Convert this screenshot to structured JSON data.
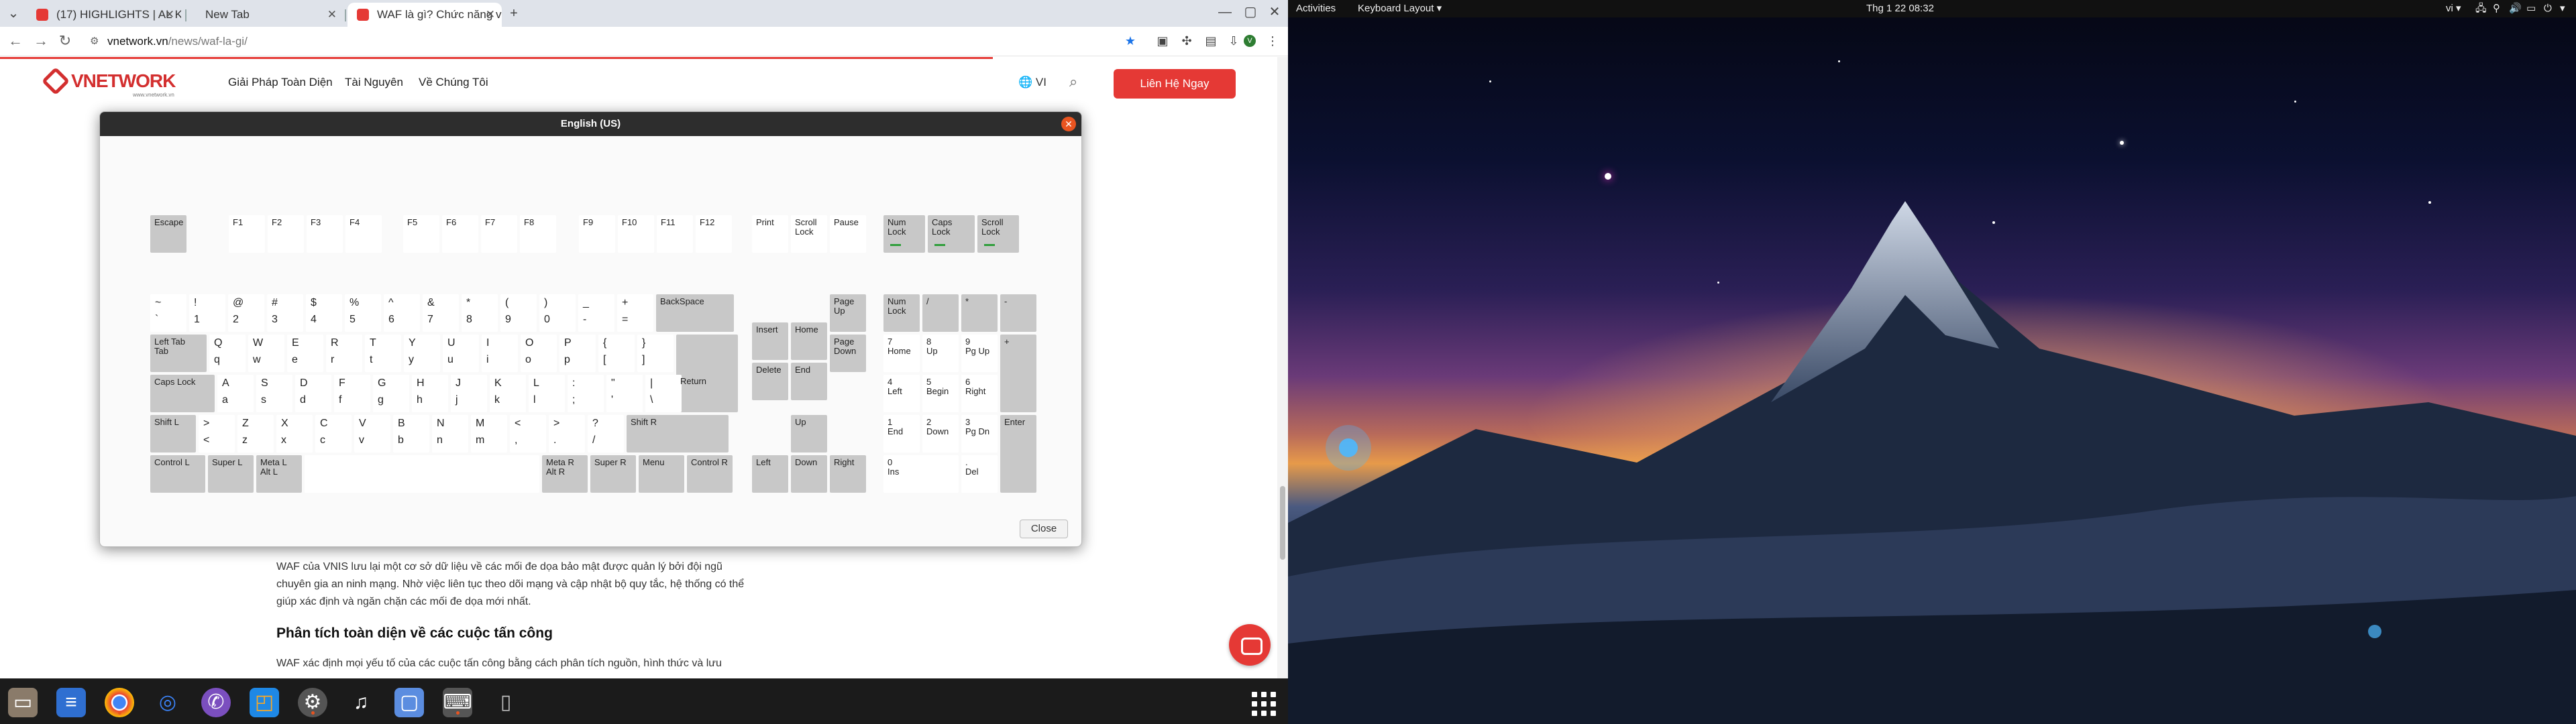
{
  "browser": {
    "tabs": [
      {
        "label": "(17) HIGHLIGHTS | AL KH",
        "active": false,
        "favicon_color": "#e53935"
      },
      {
        "label": "New Tab",
        "active": false,
        "favicon_color": "#3b3b3b"
      },
      {
        "label": "WAF là gì? Chức năng v",
        "active": true,
        "favicon_color": "#e53935"
      }
    ],
    "url_host": "vnetwork.vn",
    "url_path": "/news/waf-la-gi/"
  },
  "site": {
    "logo_text": "VNETWORK",
    "logo_tagline": "www.vnetwork.vn",
    "nav": [
      "Giải Pháp Toàn Diện",
      "Tài Nguyên",
      "Về Chúng Tôi"
    ],
    "language": "VI",
    "cta": "Liên Hệ Ngay",
    "article": {
      "paragraph_1": "WAF của VNIS lưu lại một cơ sở dữ liệu về các mối đe dọa bảo mật được quản lý bởi đội ngũ chuyên gia an ninh mạng. Nhờ việc liên tục theo dõi mạng và cập nhật bộ quy tắc, hệ thống có thể giúp xác định và ngăn chặn các mối đe dọa mới nhất.",
      "heading": "Phân tích toàn diện về các cuộc tấn công",
      "paragraph_2": "WAF xác định mọi yếu tố của các cuộc tấn công bằng cách phân tích nguồn, hình thức và lưu"
    }
  },
  "dialog": {
    "title": "English (US)",
    "close_label": "Close",
    "keys": {
      "esc": "Escape",
      "f1": "F1",
      "f2": "F2",
      "f3": "F3",
      "f4": "F4",
      "f5": "F5",
      "f6": "F6",
      "f7": "F7",
      "f8": "F8",
      "f9": "F9",
      "f10": "F10",
      "f11": "F11",
      "f12": "F12",
      "print": "Print",
      "scroll_lock": "Scroll\nLock",
      "pause": "Pause",
      "ind_num": "Num\nLock",
      "ind_caps": "Caps\nLock",
      "ind_scroll": "Scroll\nLock",
      "num_row": [
        [
          "~",
          "`"
        ],
        [
          "!",
          "1"
        ],
        [
          "@",
          "2"
        ],
        [
          "#",
          "3"
        ],
        [
          "$",
          "4"
        ],
        [
          "%",
          "5"
        ],
        [
          "^",
          "6"
        ],
        [
          "&",
          "7"
        ],
        [
          "*",
          "8"
        ],
        [
          "(",
          "9"
        ],
        [
          ")",
          "0"
        ],
        [
          "_",
          "-"
        ],
        [
          "+",
          "="
        ]
      ],
      "backspace": "BackSpace",
      "tab": "Left Tab\nTab",
      "q_row": [
        [
          "Q",
          "q"
        ],
        [
          "W",
          "w"
        ],
        [
          "E",
          "e"
        ],
        [
          "R",
          "r"
        ],
        [
          "T",
          "t"
        ],
        [
          "Y",
          "y"
        ],
        [
          "U",
          "u"
        ],
        [
          "I",
          "i"
        ],
        [
          "O",
          "o"
        ],
        [
          "P",
          "p"
        ],
        [
          "{",
          "["
        ],
        [
          "}",
          "]"
        ]
      ],
      "capslock": "Caps Lock",
      "a_row": [
        [
          "A",
          "a"
        ],
        [
          "S",
          "s"
        ],
        [
          "D",
          "d"
        ],
        [
          "F",
          "f"
        ],
        [
          "G",
          "g"
        ],
        [
          "H",
          "h"
        ],
        [
          "J",
          "j"
        ],
        [
          "K",
          "k"
        ],
        [
          "L",
          "l"
        ],
        [
          ":",
          ";"
        ],
        [
          "\"",
          "'"
        ],
        [
          "|",
          "\\"
        ]
      ],
      "return": "Return",
      "shift_l": "Shift L",
      "z_row": [
        [
          ">",
          "<"
        ],
        [
          "Z",
          "z"
        ],
        [
          "X",
          "x"
        ],
        [
          "C",
          "c"
        ],
        [
          "V",
          "v"
        ],
        [
          "B",
          "b"
        ],
        [
          "N",
          "n"
        ],
        [
          "M",
          "m"
        ],
        [
          "<",
          ","
        ],
        [
          ">",
          "."
        ],
        [
          "?",
          "/"
        ]
      ],
      "z_row_extra": [
        "¦",
        "|"
      ],
      "shift_r": "Shift R",
      "control_l": "Control L",
      "super_l": "Super L",
      "meta_l": "Meta L\nAlt L",
      "meta_r": "Meta R\nAlt R",
      "super_r": "Super R",
      "menu": "Menu",
      "control_r": "Control R",
      "insert": "Insert",
      "home": "Home",
      "page_up": "Page\nUp",
      "delete": "Delete",
      "end": "End",
      "page_down": "Page\nDown",
      "up": "Up",
      "left": "Left",
      "down": "Down",
      "right": "Right",
      "numlock": "Num\nLock",
      "kp_div": "/",
      "kp_mul": "*",
      "kp_minus": "-",
      "kp7": "7\nHome",
      "kp8": "8\nUp",
      "kp9": "9\nPg Up",
      "kp_plus": "+",
      "kp4": "4\nLeft",
      "kp5": "5\nBegin",
      "kp6": "6\nRight",
      "kp1": "1\nEnd",
      "kp2": "2\nDown",
      "kp3": "3\nPg Dn",
      "kp_enter": "Enter",
      "kp0": "0\nIns",
      "kp_dot": ".\nDel"
    }
  },
  "topbar": {
    "activities": "Activities",
    "app_menu": "Keyboard Layout",
    "clock": "Thg 1 22  08:32",
    "input_lang": "vi"
  },
  "dock": [
    "files-icon",
    "text-editor-icon",
    "chrome-icon",
    "network-icon",
    "viber-icon",
    "remote-desktop-icon",
    "settings-icon",
    "music-icon",
    "screen-icon",
    "keyboard-icon",
    "trash-icon"
  ]
}
